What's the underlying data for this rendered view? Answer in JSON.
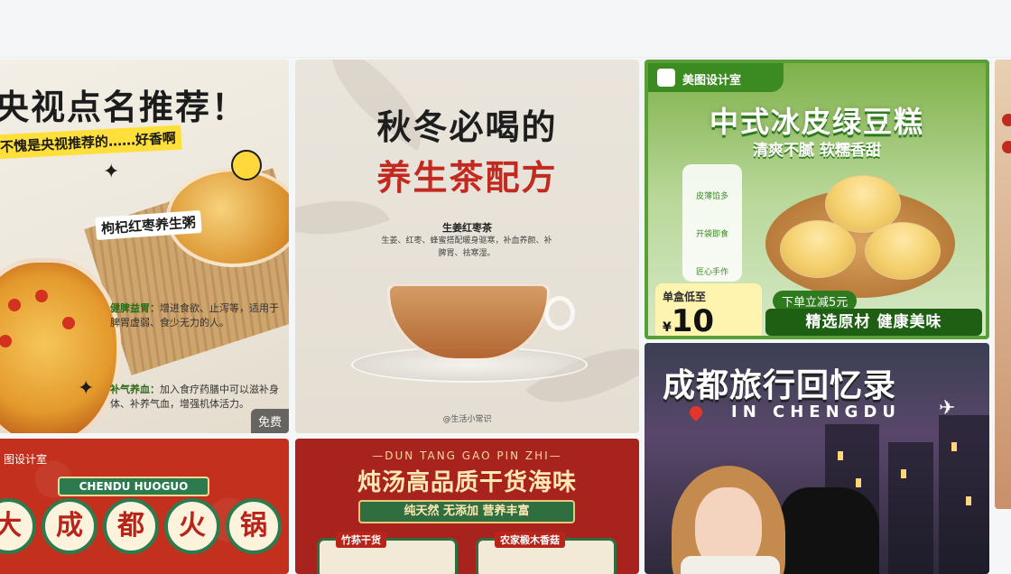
{
  "cards": {
    "card1": {
      "title": "央视点名推荐！",
      "subtitle": "不愧是央视推荐的……好香啊",
      "tag": "枸杞红枣养生粥",
      "note1_head": "健脾益胃：",
      "note1_body": "增进食欲、止泻等，适用于脾胃虚弱、食少无力的人。",
      "note2_head": "补气养血：",
      "note2_body": "加入食疗药膳中可以滋补身体、补养气血，增强机体活力。",
      "badge": "免费"
    },
    "card2": {
      "title_line1": "秋冬必喝的",
      "title_line2": "养生茶配方",
      "recipe_name": "生姜红枣茶",
      "recipe_desc": "生姜、红枣、蜂蜜搭配暖身驱寒，补血养颜、补脾胃、祛寒湿。",
      "credit": "@生活小常识"
    },
    "card3": {
      "brand": "美图设计室",
      "title": "中式冰皮绿豆糕",
      "subtitle": "清爽不腻 软糯香甜",
      "features": [
        "皮薄馅多",
        "开袋即食",
        "匠心手作"
      ],
      "price_label": "单盒低至",
      "price_currency": "¥",
      "price_value": "10",
      "promo": "下单立减5元",
      "slogan": "精选原材 健康美味"
    },
    "card5": {
      "brand": "图设计室",
      "ribbon": "CHENDU HUOGUO",
      "chars": [
        "大",
        "成",
        "都",
        "火",
        "锅"
      ]
    },
    "card6": {
      "pinyin": "—DUN TANG GAO PIN ZHI—",
      "title": "炖汤高品质干货海味",
      "ribbon": "纯天然 无添加 营养丰富",
      "box1": "竹荪干货",
      "box2": "农家椴木香菇"
    },
    "card7": {
      "title": "成都旅行回忆录",
      "subtitle": "IN CHENGDU"
    }
  },
  "colors": {
    "red": "#c22a20",
    "green": "#3b8a22",
    "yellow": "#ffdf3a"
  }
}
